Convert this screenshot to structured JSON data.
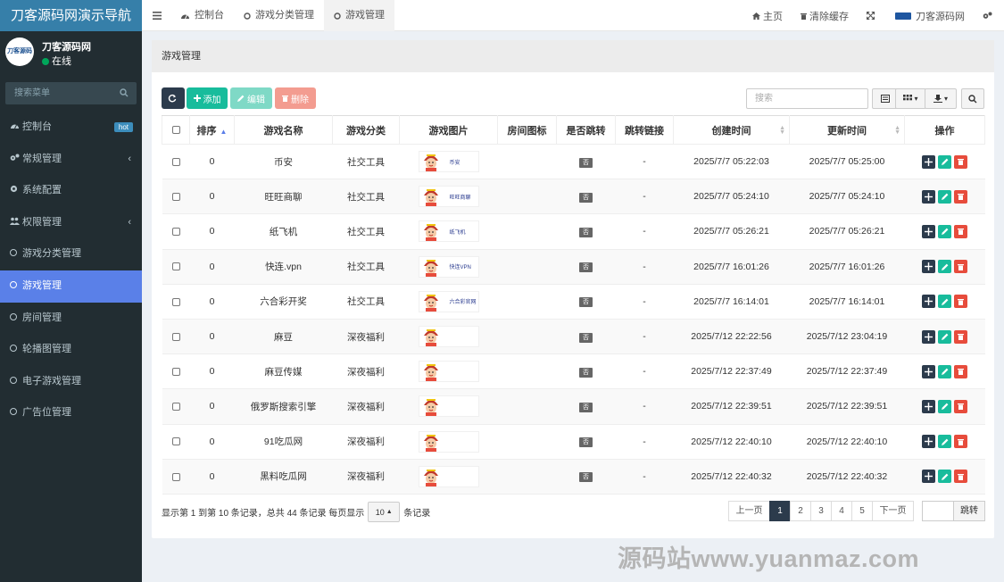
{
  "app": {
    "title": "刀客源码网演示导航"
  },
  "user": {
    "name": "刀客源码网",
    "status": "在线",
    "avatar_text": "刀客源码"
  },
  "sidebar": {
    "search_placeholder": "搜索菜单",
    "items": [
      {
        "label": "控制台",
        "icon": "dashboard-icon",
        "badge": "hot"
      },
      {
        "label": "常规管理",
        "icon": "cogs-icon",
        "caret": "‹"
      },
      {
        "label": "系统配置",
        "icon": "gear-icon"
      },
      {
        "label": "权限管理",
        "icon": "users-icon",
        "caret": "‹"
      },
      {
        "label": "游戏分类管理",
        "icon": "circle-icon"
      },
      {
        "label": "游戏管理",
        "icon": "circle-icon",
        "active": true
      },
      {
        "label": "房间管理",
        "icon": "circle-icon"
      },
      {
        "label": "轮播图管理",
        "icon": "circle-icon"
      },
      {
        "label": "电子游戏管理",
        "icon": "circle-icon"
      },
      {
        "label": "广告位管理",
        "icon": "circle-icon"
      }
    ]
  },
  "topbar": {
    "tabs": [
      {
        "label": "控制台",
        "icon": "dashboard-icon"
      },
      {
        "label": "游戏分类管理",
        "icon": "circle-icon"
      },
      {
        "label": "游戏管理",
        "icon": "circle-icon",
        "active": true
      }
    ],
    "home": "主页",
    "clear_cache": "清除缓存",
    "site_name": "刀客源码网"
  },
  "panel": {
    "title": "游戏管理"
  },
  "toolbar": {
    "add": "添加",
    "edit": "编辑",
    "delete": "删除",
    "search_placeholder": "搜索"
  },
  "table": {
    "headers": [
      "排序",
      "游戏名称",
      "游戏分类",
      "游戏图片",
      "房间图标",
      "是否跳转",
      "跳转链接",
      "创建时间",
      "更新时间",
      "操作"
    ],
    "rows": [
      {
        "sort": "0",
        "name": "币安",
        "category": "社交工具",
        "image_text": "币安",
        "jump": "否",
        "link": "-",
        "created": "2025/7/7 05:22:03",
        "updated": "2025/7/7 05:25:00"
      },
      {
        "sort": "0",
        "name": "旺旺商聊",
        "category": "社交工具",
        "image_text": "旺旺商聊",
        "jump": "否",
        "link": "-",
        "created": "2025/7/7 05:24:10",
        "updated": "2025/7/7 05:24:10"
      },
      {
        "sort": "0",
        "name": "纸飞机",
        "category": "社交工具",
        "image_text": "纸飞机",
        "jump": "否",
        "link": "-",
        "created": "2025/7/7 05:26:21",
        "updated": "2025/7/7 05:26:21"
      },
      {
        "sort": "0",
        "name": "快连.vpn",
        "category": "社交工具",
        "image_text": "快连VPN",
        "jump": "否",
        "link": "-",
        "created": "2025/7/7 16:01:26",
        "updated": "2025/7/7 16:01:26"
      },
      {
        "sort": "0",
        "name": "六合彩开奖",
        "category": "社交工具",
        "image_text": "六合彩官网",
        "jump": "否",
        "link": "-",
        "created": "2025/7/7 16:14:01",
        "updated": "2025/7/7 16:14:01"
      },
      {
        "sort": "0",
        "name": "麻豆",
        "category": "深夜福利",
        "image_text": "",
        "jump": "否",
        "link": "-",
        "created": "2025/7/12 22:22:56",
        "updated": "2025/7/12 23:04:19"
      },
      {
        "sort": "0",
        "name": "麻豆传媒",
        "category": "深夜福利",
        "image_text": "",
        "jump": "否",
        "link": "-",
        "created": "2025/7/12 22:37:49",
        "updated": "2025/7/12 22:37:49"
      },
      {
        "sort": "0",
        "name": "俄罗斯搜索引擎",
        "category": "深夜福利",
        "image_text": "",
        "jump": "否",
        "link": "-",
        "created": "2025/7/12 22:39:51",
        "updated": "2025/7/12 22:39:51"
      },
      {
        "sort": "0",
        "name": "91吃瓜网",
        "category": "深夜福利",
        "image_text": "",
        "jump": "否",
        "link": "-",
        "created": "2025/7/12 22:40:10",
        "updated": "2025/7/12 22:40:10"
      },
      {
        "sort": "0",
        "name": "黑料吃瓜网",
        "category": "深夜福利",
        "image_text": "",
        "jump": "否",
        "link": "-",
        "created": "2025/7/12 22:40:32",
        "updated": "2025/7/12 22:40:32"
      }
    ]
  },
  "footer": {
    "info_before": "显示第 1 到第 10 条记录，总共 44 条记录 每页显示",
    "page_size": "10",
    "info_after": "条记录",
    "prev": "上一页",
    "pages": [
      "1",
      "2",
      "3",
      "4",
      "5"
    ],
    "current_page": "1",
    "next": "下一页",
    "go": "跳转"
  },
  "watermark": "源码站www.yuanmaz.com",
  "colors": {
    "sidebar_bg": "#222d32",
    "logo_bg": "#367fa9",
    "active_menu": "#5a80e8",
    "primary_dark": "#2c3b4c",
    "success": "#18bc9c",
    "danger": "#e74c3c"
  }
}
